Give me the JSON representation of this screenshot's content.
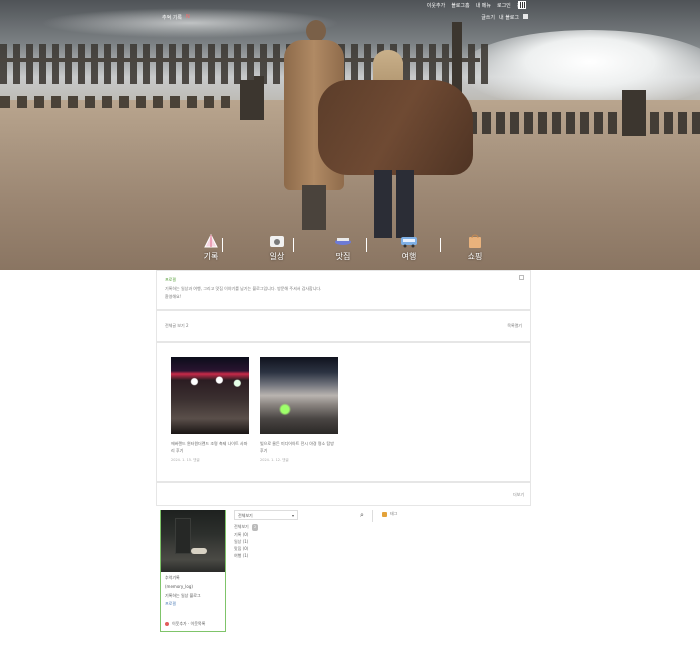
{
  "header": {
    "blog_title": "추억 기록",
    "blog_new": "N",
    "top_links": [
      "이웃추가",
      "블로그홈",
      "내 메뉴",
      "로그인",
      "검색"
    ],
    "user_links": [
      "글쓰기",
      "내 블로그"
    ],
    "menu": [
      {
        "label": "기록",
        "icon": "pen-icon"
      },
      {
        "label": "일상",
        "icon": "camera-icon"
      },
      {
        "label": "맛집",
        "icon": "dish-icon"
      },
      {
        "label": "여행",
        "icon": "bus-icon"
      },
      {
        "label": "쇼핑",
        "icon": "bag-icon"
      }
    ]
  },
  "notice": {
    "name": "프로필",
    "text": "기록하는 일상과 여행, 그리고 맛집 이야기를 남기는 블로그입니다. 방문해 주셔서 감사합니다.",
    "text2": "환영해요!"
  },
  "post_header": {
    "left": "전체글 보기 2",
    "right": "목록열기"
  },
  "posts": [
    {
      "title": "에버랜드 윈터원더랜드 조명 축제 나이트 사파리 후기",
      "meta": "2024. 1. 15.  댓글"
    },
    {
      "title": "빛으로 물든 미디어아트 전시 야경 명소 탐방 후기",
      "meta": "2024. 1. 12.  댓글"
    }
  ],
  "list_footer": "더보기",
  "profile": {
    "name": "추억기록",
    "id": "(memory_log)",
    "desc": "기록하는 일상 블로그",
    "link": "프로필",
    "footer": "이웃추가 · 이웃목록"
  },
  "category": {
    "selected": "전체보기",
    "items": [
      {
        "label": "전체보기",
        "count": "2"
      },
      {
        "label": "기록 (0)"
      },
      {
        "label": "일상 (1)"
      },
      {
        "label": "맛집 (0)"
      },
      {
        "label": "여행 (1)"
      }
    ]
  },
  "tags": {
    "label": "태그"
  }
}
